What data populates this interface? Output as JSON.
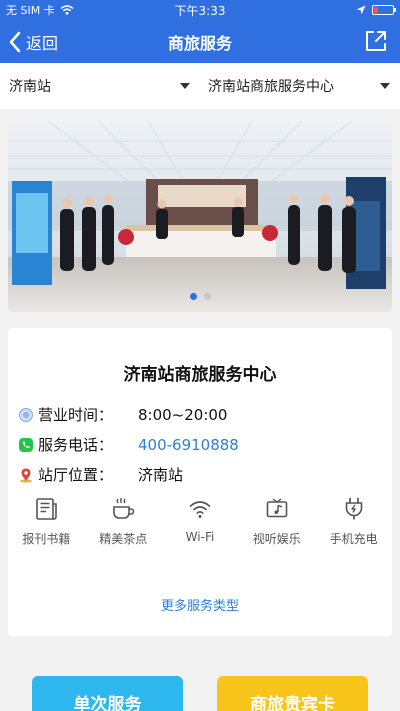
{
  "status_bar": {
    "carrier": "无 SIM 卡",
    "time": "下午3:33"
  },
  "nav": {
    "back_label": "返回",
    "title": "商旅服务"
  },
  "selectors": {
    "station": "济南站",
    "center": "济南站商旅服务中心"
  },
  "banner": {
    "active_slide": 1,
    "slide_count": 2
  },
  "info": {
    "name": "济南站商旅服务中心",
    "hours_label": "营业时间：",
    "hours_value": "8:00~20:00",
    "phone_label": "服务电话：",
    "phone_value": "400-6910888",
    "location_label": "站厅位置：",
    "location_value": "济南站"
  },
  "services": [
    {
      "label": "报刊书籍",
      "icon": "newspaper-icon"
    },
    {
      "label": "精美茶点",
      "icon": "coffee-cup-icon"
    },
    {
      "label": "Wi-Fi",
      "icon": "wifi-icon"
    },
    {
      "label": "视听娱乐",
      "icon": "media-icon"
    },
    {
      "label": "手机充电",
      "icon": "charging-plug-icon"
    }
  ],
  "more_services_label": "更多服务类型",
  "buttons": {
    "single_service": "单次服务",
    "vip_card": "商旅贵宾卡"
  },
  "colors": {
    "brand_blue": "#2f6fe0",
    "link_blue": "#2f7ed8",
    "button_cyan": "#2db7ee",
    "button_yellow": "#f7c51a"
  }
}
